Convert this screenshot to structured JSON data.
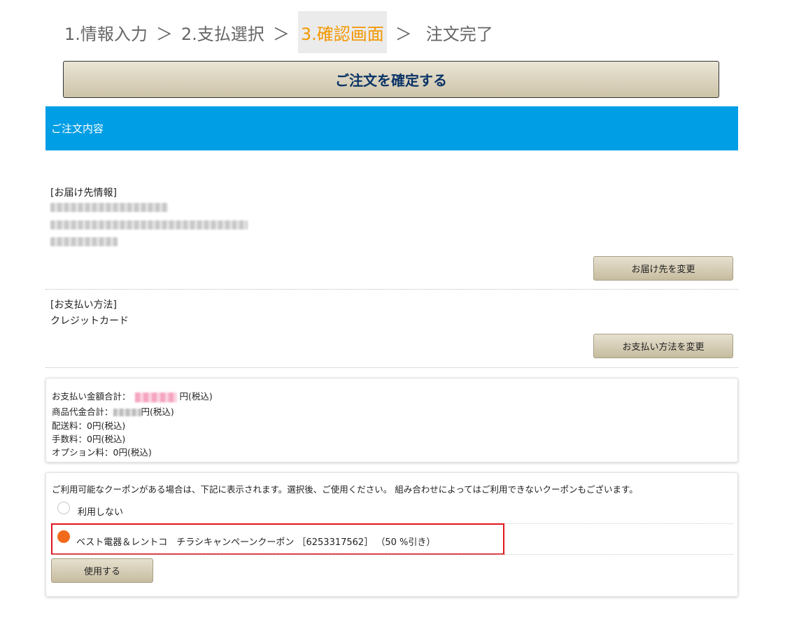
{
  "steps": {
    "step1": "1.情報入力",
    "step2": "2.支払選択",
    "step3": "3.確認画面",
    "step4": "注文完了",
    "separator": "＞"
  },
  "confirm_button": "ご注文を確定する",
  "order_section": {
    "title": "ご注文内容"
  },
  "delivery": {
    "label": "[お届け先情報]",
    "change_button": "お届け先を変更"
  },
  "payment": {
    "label": "[お支払い方法]",
    "method": "クレジットカード",
    "change_button": "お支払い方法を変更"
  },
  "totals": {
    "total_label": "お支払い金額合計：",
    "total_suffix": "円(税込)",
    "subtotal_label": "商品代金合計：",
    "subtotal_suffix": "円(税込)",
    "shipping": "配送料：0円(税込)",
    "fee": "手数料：0円(税込)",
    "option": "オプション料：0円(税込)"
  },
  "coupon": {
    "notice": "ご利用可能なクーポンがある場合は、下記に表示されます。選択後、ご使用ください。 組み合わせによってはご利用できないクーポンもございます。",
    "option_none": "利用しない",
    "option_coupon": "ベスト電器＆レントコ　チラシキャンペーンクーポン ［6253317562］ （50 %引き）",
    "use_button": "使用する",
    "selected_color": "#f26a1b",
    "highlight_color": "#e0141e"
  },
  "colors": {
    "accent_header": "#009ee5",
    "active_step": "#f39700",
    "confirm_text": "#0a3366"
  }
}
